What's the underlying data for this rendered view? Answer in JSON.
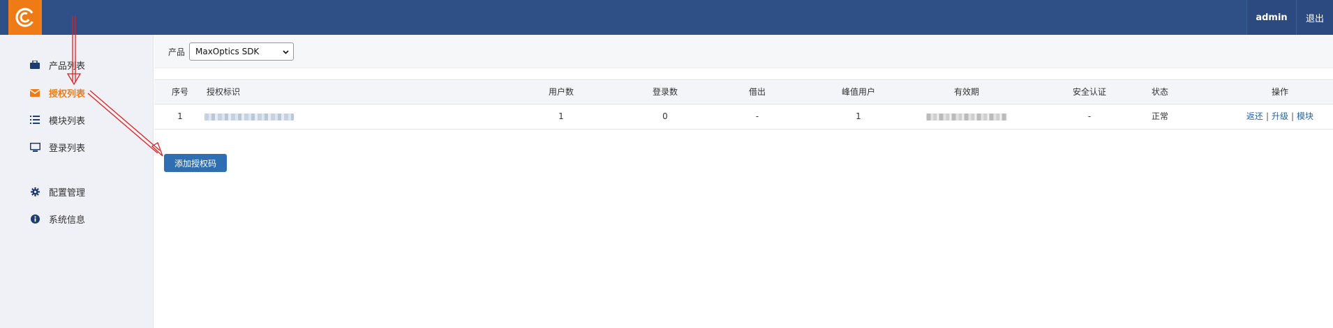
{
  "topbar": {
    "logo_icon": "brand-logo-icon",
    "user": "admin",
    "logout": "退出"
  },
  "sidebar": {
    "items": [
      {
        "label": "产品列表",
        "icon": "briefcase-icon",
        "active": false
      },
      {
        "label": "授权列表",
        "icon": "envelope-icon",
        "active": true
      },
      {
        "label": "模块列表",
        "icon": "list-icon",
        "active": false
      },
      {
        "label": "登录列表",
        "icon": "monitor-icon",
        "active": false
      },
      {
        "label": "配置管理",
        "icon": "gear-icon",
        "active": false
      },
      {
        "label": "系统信息",
        "icon": "info-icon",
        "active": false
      }
    ]
  },
  "filter": {
    "label": "产品",
    "selected": "MaxOptics SDK"
  },
  "table": {
    "headers": [
      "序号",
      "授权标识",
      "用户数",
      "登录数",
      "借出",
      "峰值用户",
      "有效期",
      "安全认证",
      "状态",
      "操作"
    ],
    "rows": [
      {
        "index": "1",
        "users": "1",
        "logins": "0",
        "lent": "-",
        "peak": "1",
        "security": "-",
        "status": "正常",
        "ops": [
          "返还",
          "升级",
          "模块"
        ],
        "ops_sep": "|"
      }
    ]
  },
  "actions": {
    "add_label": "添加授权码"
  },
  "colors": {
    "topbar": "#2f4f87",
    "brand": "#ef7b16",
    "button": "#2f6eb0",
    "link": "#2563a8",
    "annotation_arrow": "#e02020"
  }
}
